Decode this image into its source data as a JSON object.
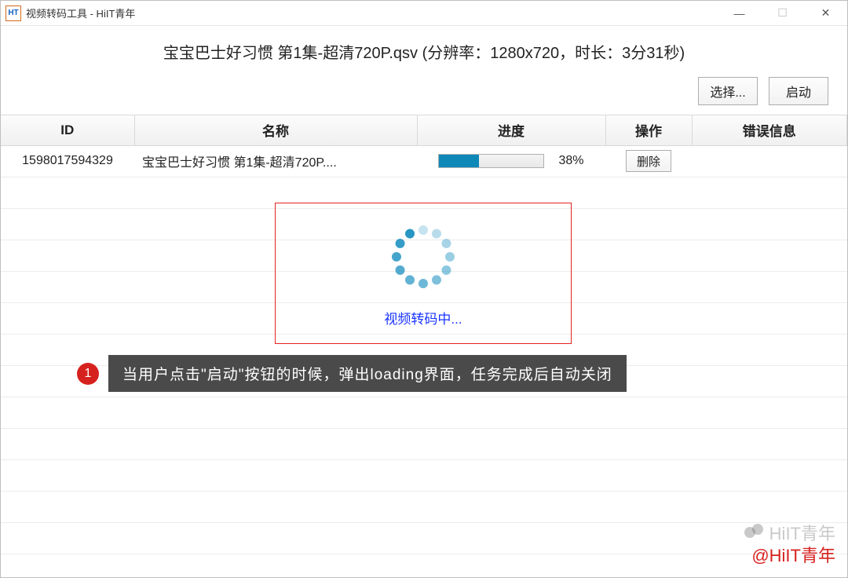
{
  "titlebar": {
    "title": "视频转码工具 - HiIT青年"
  },
  "header": {
    "file_info": "宝宝巴士好习惯 第1集-超清720P.qsv (分辨率：1280x720，时长：3分31秒)",
    "select_label": "选择...",
    "start_label": "启动"
  },
  "table": {
    "columns": {
      "id": "ID",
      "name": "名称",
      "progress": "进度",
      "action": "操作",
      "error": "错误信息"
    },
    "rows": [
      {
        "id": "1598017594329",
        "name": "宝宝巴士好习惯 第1集-超清720P....",
        "progress_pct": 38,
        "progress_text": "38%",
        "action_label": "删除",
        "error": ""
      }
    ]
  },
  "loading": {
    "text": "视频转码中..."
  },
  "annotation": {
    "badge": "1",
    "text": "当用户点击\"启动\"按钮的时候，弹出loading界面，任务完成后自动关闭"
  },
  "watermark": {
    "faint": "HiIT青年",
    "red": "@HiIT青年"
  }
}
